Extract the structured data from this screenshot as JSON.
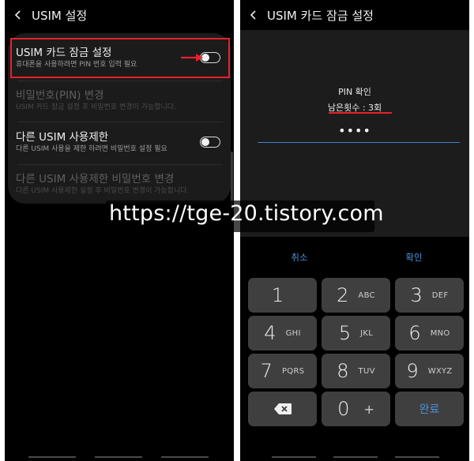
{
  "watermark": "https://tge-20.tistory.com",
  "left_screen": {
    "title": "USIM 설정",
    "rows": [
      {
        "title": "USIM 카드 잠금 설정",
        "subtitle": "휴대폰을 사용하려면 PIN 번호 입력 필요",
        "toggle": "off",
        "enabled": true
      },
      {
        "title": "비밀번호(PIN) 변경",
        "subtitle": "USIM 카드 잠금 설정 후 비밀번호 변경이 가능합니다.",
        "enabled": false
      },
      {
        "title": "다른 USIM 사용제한",
        "subtitle": "다른 USIM 사용을 제한 하려면 비밀번호 설정 필요",
        "toggle": "off",
        "enabled": true
      },
      {
        "title": "다른 USIM 사용제한 비밀번호 변경",
        "subtitle": "다른 USIM 사용제한 설정 후 비밀번호 변경이 가능합니다.",
        "enabled": false
      }
    ],
    "annotation_color": "#e8202a"
  },
  "right_screen": {
    "title": "USIM 카드 잠금 설정",
    "pin_label": "PIN 확인",
    "tries_label": "남은횟수 : 3회",
    "pin_dots": "••••",
    "actions": {
      "cancel": "취소",
      "confirm": "확인"
    },
    "keys": [
      {
        "digit": "1",
        "letters": ""
      },
      {
        "digit": "2",
        "letters": "ABC"
      },
      {
        "digit": "3",
        "letters": "DEF"
      },
      {
        "digit": "4",
        "letters": "GHI"
      },
      {
        "digit": "5",
        "letters": "JKL"
      },
      {
        "digit": "6",
        "letters": "MNO"
      },
      {
        "digit": "7",
        "letters": "PQRS"
      },
      {
        "digit": "8",
        "letters": "TUV"
      },
      {
        "digit": "9",
        "letters": "WXYZ"
      }
    ],
    "bottom_keys": {
      "backspace_icon": "backspace-icon",
      "zero": "0",
      "plus": "+",
      "done": "완료"
    },
    "accent_color": "#4a90d9"
  }
}
